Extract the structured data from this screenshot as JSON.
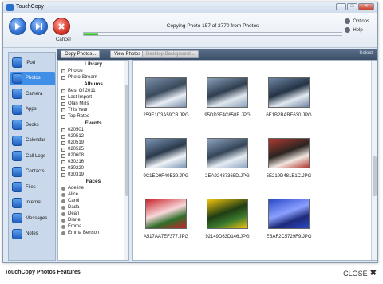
{
  "window": {
    "title": "TouchCopy",
    "controls": {
      "minimize": "–",
      "maximize": "□",
      "close": "✕"
    }
  },
  "toolbar": {
    "cancel_label": "Cancel",
    "progress_text": "Copying Photo 157 of 2770 from Photos",
    "progress_fraction": 0.057,
    "options_label": "Options",
    "help_label": "Help"
  },
  "nav": [
    {
      "label": "iPod",
      "icon": "ipod-icon",
      "active": false
    },
    {
      "label": "Photos",
      "icon": "photos-icon",
      "active": true
    },
    {
      "label": "Camera",
      "icon": "camera-icon",
      "active": false
    },
    {
      "label": "Apps",
      "icon": "apps-icon",
      "active": false
    },
    {
      "label": "Books",
      "icon": "books-icon",
      "active": false
    },
    {
      "label": "Calendar",
      "icon": "calendar-icon",
      "active": false
    },
    {
      "label": "Call Logs",
      "icon": "phone-icon",
      "active": false
    },
    {
      "label": "Contacts",
      "icon": "contacts-icon",
      "active": false
    },
    {
      "label": "Files",
      "icon": "files-icon",
      "active": false
    },
    {
      "label": "Internet",
      "icon": "globe-icon",
      "active": false
    },
    {
      "label": "Messages",
      "icon": "messages-icon",
      "active": false
    },
    {
      "label": "Notes",
      "icon": "notes-icon",
      "active": false
    }
  ],
  "contentbar": {
    "copy_photos": "Copy Photos...",
    "view_photos": "View Photos",
    "desktop_background": "Desktop Background...",
    "select": "Select"
  },
  "tree": {
    "library_header": "Library",
    "library": [
      "Photos",
      "Photo Stream"
    ],
    "albums_header": "Albums",
    "albums": [
      "Best Of 2011",
      "Last Import",
      "Olan Mills",
      "This Year",
      "Top Rated"
    ],
    "events_header": "Events",
    "events": [
      "020501",
      "020512",
      "020519",
      "020525",
      "020608",
      "030216",
      "030220",
      "030319"
    ],
    "faces_header": "Faces",
    "faces": [
      "Adeline",
      "Alice",
      "Carol",
      "Dada",
      "Dean",
      "Diane",
      "Emma",
      "Emma Benson"
    ]
  },
  "photos": [
    {
      "name": "259E1C3A59CB.JPG",
      "colors": [
        "#7a8fa8",
        "#e8eef5",
        "#3a4a5c"
      ]
    },
    {
      "name": "95DD3F4C658E.JPG",
      "colors": [
        "#8aa0ba",
        "#dfe6ee",
        "#2f3d4f"
      ]
    },
    {
      "name": "6E1B2BABE630.JPG",
      "colors": [
        "#6f86a3",
        "#e2e9f1",
        "#243345"
      ]
    },
    {
      "name": "9C1ED9F40E39.JPG",
      "colors": [
        "#7d97b6",
        "#f0f4f8",
        "#2b3a4c"
      ]
    },
    {
      "name": "2EA92437365D.JPG",
      "colors": [
        "#8ea5c0",
        "#e5ecf3",
        "#344558"
      ]
    },
    {
      "name": "5E219D481E1C.JPG",
      "colors": [
        "#b03a32",
        "#f2e6e0",
        "#2a2420"
      ]
    },
    {
      "name": "A517AA7EF377.JPG",
      "colors": [
        "#c8242c",
        "#2f6e2a",
        "#f7d7d9"
      ]
    },
    {
      "name": "92149D63D146.JPG",
      "colors": [
        "#f1c40f",
        "#3c7a2e",
        "#1f3d14"
      ]
    },
    {
      "name": "EBAF2C5729F9.JPG",
      "colors": [
        "#2a48c8",
        "#1d2a7a",
        "#8aa0ff"
      ]
    }
  ],
  "caption": "TouchCopy Photos Features",
  "close_label": "CLOSE"
}
